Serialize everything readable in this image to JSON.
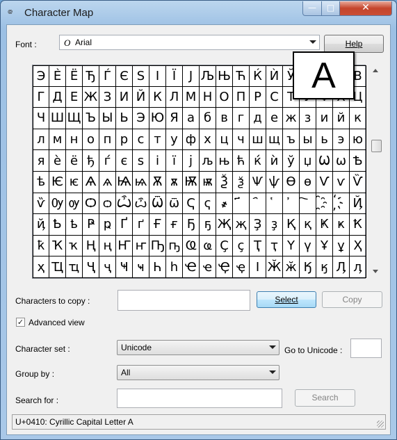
{
  "window": {
    "title": "Character Map",
    "icon": "character-map-app-icon",
    "min_glyph": "—",
    "max_glyph": "□",
    "close_glyph": "✕"
  },
  "font": {
    "label": "Font :",
    "value": "Arial",
    "font_icon_glyph": "O",
    "help_label": "Help"
  },
  "grid": {
    "rows": [
      [
        "Э",
        "Ѐ",
        "Ё",
        "Ђ",
        "Ѓ",
        "Є",
        "Ѕ",
        "І",
        "Ї",
        "Ј",
        "Љ",
        "Њ",
        "Ћ",
        "Ќ",
        "Ѝ",
        "Ў",
        "Џ",
        "А",
        "Б",
        "В"
      ],
      [
        "Г",
        "Д",
        "Е",
        "Ж",
        "З",
        "И",
        "Й",
        "К",
        "Л",
        "М",
        "Н",
        "О",
        "П",
        "Р",
        "С",
        "Т",
        "У",
        "Ф",
        "Х",
        "Ц"
      ],
      [
        "Ч",
        "Ш",
        "Щ",
        "Ъ",
        "Ы",
        "Ь",
        "Э",
        "Ю",
        "Я",
        "а",
        "б",
        "в",
        "г",
        "д",
        "е",
        "ж",
        "з",
        "и",
        "й",
        "к"
      ],
      [
        "л",
        "м",
        "н",
        "о",
        "п",
        "р",
        "с",
        "т",
        "у",
        "ф",
        "х",
        "ц",
        "ч",
        "ш",
        "щ",
        "ъ",
        "ы",
        "ь",
        "э",
        "ю"
      ],
      [
        "я",
        "ѐ",
        "ё",
        "ђ",
        "ѓ",
        "є",
        "ѕ",
        "і",
        "ї",
        "ј",
        "љ",
        "њ",
        "ћ",
        "ќ",
        "ѝ",
        "ў",
        "џ",
        "Ѡ",
        "ѡ",
        "Ѣ"
      ],
      [
        "ѣ",
        "Ѥ",
        "ѥ",
        "Ѧ",
        "ѧ",
        "Ѩ",
        "ѩ",
        "Ѫ",
        "ѫ",
        "Ѭ",
        "ѭ",
        "Ѯ",
        "ѯ",
        "Ѱ",
        "ѱ",
        "Ѳ",
        "ѳ",
        "Ѵ",
        "ѵ",
        "Ѷ"
      ],
      [
        "ѷ",
        "Ѹ",
        "ѹ",
        "Ѻ",
        "ѻ",
        "Ѽ",
        "ѽ",
        "Ѿ",
        "ѿ",
        "Ҁ",
        "ҁ",
        "҂",
        "҃",
        "҄",
        "҅",
        "҆",
        "҇",
        "҈",
        "҉",
        "Ҋ"
      ],
      [
        "ҋ",
        "Ҍ",
        "ҍ",
        "Ҏ",
        "ҏ",
        "Ґ",
        "ґ",
        "Ғ",
        "ғ",
        "Ҕ",
        "ҕ",
        "Җ",
        "җ",
        "Ҙ",
        "ҙ",
        "Қ",
        "қ",
        "Ҝ",
        "ҝ",
        "Ҟ"
      ],
      [
        "ҟ",
        "Ҡ",
        "ҡ",
        "Ң",
        "ң",
        "Ҥ",
        "ҥ",
        "Ҧ",
        "ҧ",
        "Ҩ",
        "ҩ",
        "Ҫ",
        "ҫ",
        "Ҭ",
        "ҭ",
        "Ү",
        "ү",
        "Ұ",
        "ұ",
        "Ҳ"
      ],
      [
        "ҳ",
        "Ҵ",
        "ҵ",
        "Ҷ",
        "ҷ",
        "Ҹ",
        "ҹ",
        "Һ",
        "һ",
        "Ҽ",
        "ҽ",
        "Ҿ",
        "ҿ",
        "Ӏ",
        "Ӂ",
        "ӂ",
        "Ӄ",
        "ӄ",
        "Ӆ",
        "ӆ"
      ]
    ],
    "zoom_char": "A"
  },
  "copy": {
    "label": "Characters to copy :",
    "value": "",
    "select_label": "Select",
    "copy_label": "Copy"
  },
  "advanced": {
    "label": "Advanced view",
    "checked_glyph": "✓"
  },
  "charset": {
    "label": "Character set :",
    "value": "Unicode",
    "goto_label": "Go to Unicode :",
    "goto_value": ""
  },
  "groupby": {
    "label": "Group by :",
    "value": "All"
  },
  "search": {
    "label": "Search for :",
    "value": "",
    "button_label": "Search"
  },
  "status": {
    "text": "U+0410: Cyrillic Capital Letter A"
  }
}
